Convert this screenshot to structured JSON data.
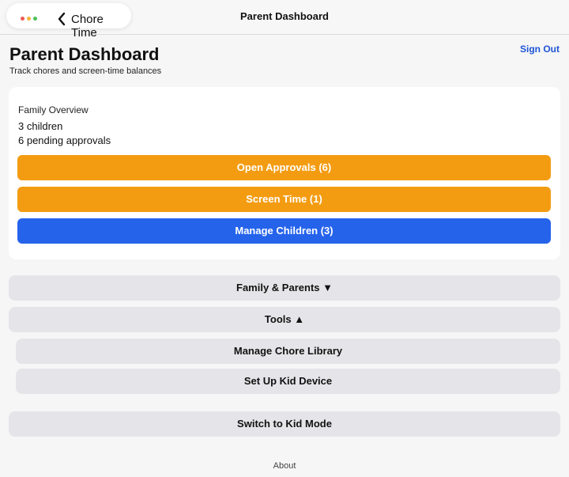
{
  "header": {
    "back_label": "Chore Time",
    "nav_title": "Parent Dashboard",
    "window_dot_colors": [
      "#ee5a52",
      "#f5b53d",
      "#4cc15a"
    ]
  },
  "page": {
    "title": "Parent Dashboard",
    "subtitle": "Track chores and screen-time balances",
    "sign_out_label": "Sign Out"
  },
  "overview": {
    "heading": "Family Overview",
    "children_count": "3 children",
    "pending_approvals": "6 pending approvals",
    "buttons": {
      "open_approvals": "Open Approvals (6)",
      "screen_time": "Screen Time (1)",
      "manage_children": "Manage Children (3)"
    }
  },
  "sections": {
    "family_parents": "Family & Parents ▼",
    "tools": "Tools ▲",
    "manage_chore_library": "Manage Chore Library",
    "set_up_kid_device": "Set Up Kid Device",
    "switch_kid_mode": "Switch to Kid Mode"
  },
  "footer": {
    "about": "About"
  },
  "colors": {
    "accent_orange": "#f39c12",
    "accent_blue": "#2563eb",
    "link_blue": "#1f55d6",
    "gray_button": "#e5e5e9"
  }
}
